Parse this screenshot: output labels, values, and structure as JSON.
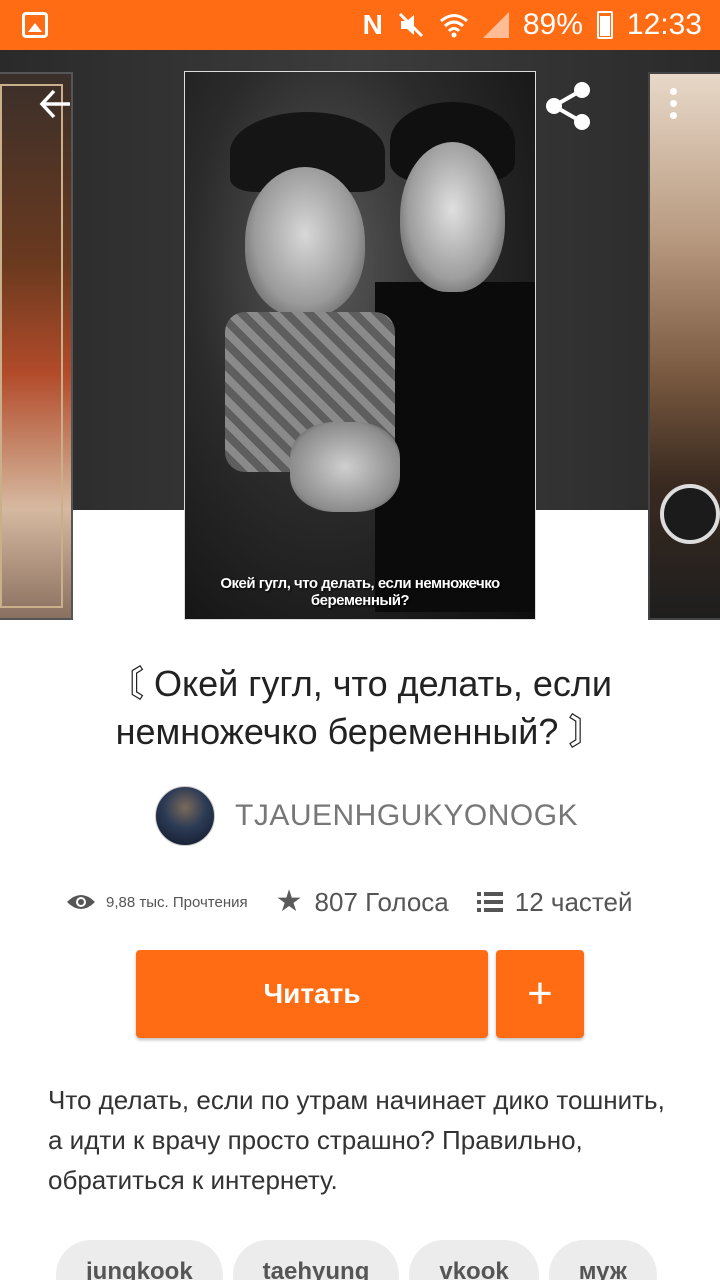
{
  "status_bar": {
    "battery_percent": "89%",
    "time": "12:33",
    "icons": [
      "gallery-icon",
      "nfc-icon",
      "mute-icon",
      "wifi-icon",
      "signal-icon",
      "battery-icon"
    ]
  },
  "colors": {
    "accent": "#ff6c14",
    "hero_background": "#333333"
  },
  "toolbar": {
    "icons": [
      "back-arrow-icon",
      "share-icon",
      "more-vert-icon"
    ]
  },
  "cover": {
    "caption": "Окей гугл, что делать, если немножечко беременный?"
  },
  "story": {
    "title": "〘 Окей гугл, что делать, если немножечко беременный? 〙",
    "author": "TJAUENHGUKYONOGK",
    "reads": "9,88 тыс. Прочтения",
    "votes": "807 Голоса",
    "parts": "12 частей",
    "description": "Что делать, если по утрам начинает дико тошнить, а идти к врачу просто страшно? Правильно, обратиться к интернету."
  },
  "actions": {
    "read_label": "Читать",
    "add_label": "+"
  },
  "tags": [
    "jungkook",
    "taehyung",
    "vkook",
    "муж"
  ]
}
